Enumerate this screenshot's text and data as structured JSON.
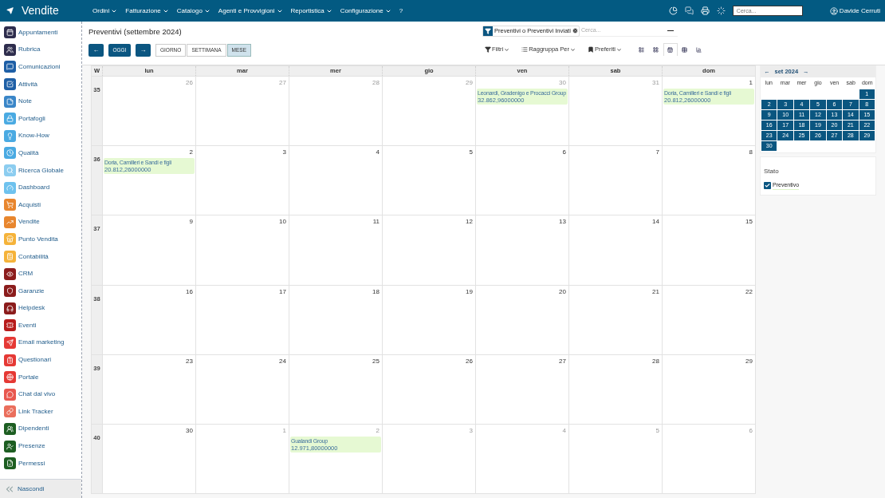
{
  "app": {
    "title": "Vendite"
  },
  "menus": [
    {
      "label": "Ordini",
      "dropdown": true
    },
    {
      "label": "Fatturazione",
      "dropdown": true
    },
    {
      "label": "Catalogo",
      "dropdown": true
    },
    {
      "label": "Agenti e Provvigioni",
      "dropdown": true
    },
    {
      "label": "Reportistica",
      "dropdown": true
    },
    {
      "label": "Configurazione",
      "dropdown": true
    },
    {
      "label": "?",
      "dropdown": false
    }
  ],
  "top_search": {
    "placeholder": "Cerca..."
  },
  "user": {
    "name": "Davide Cerruti"
  },
  "sidebar": {
    "items": [
      {
        "label": "Appuntamenti",
        "color": "#2e2d4d"
      },
      {
        "label": "Rubrica",
        "color": "#2e2d4d"
      },
      {
        "label": "Comunicazioni",
        "color": "#1e5fa6"
      },
      {
        "label": "Attività",
        "color": "#1e5fa6"
      },
      {
        "label": "Note",
        "color": "#3a86c8"
      },
      {
        "label": "Portafogli",
        "color": "#4aaae2"
      },
      {
        "label": "Know-How",
        "color": "#4aaae2"
      },
      {
        "label": "Qualità",
        "color": "#4aaae2"
      },
      {
        "label": "Ricerca Globale",
        "color": "#8ccdf0"
      },
      {
        "label": "Dashboard",
        "color": "#6ec2ee"
      },
      {
        "label": "Acquisti",
        "color": "#e8862e"
      },
      {
        "label": "Vendite",
        "color": "#e8862e"
      },
      {
        "label": "Punto Vendita",
        "color": "#f5b33a"
      },
      {
        "label": "Contabilità",
        "color": "#f5b33a"
      },
      {
        "label": "CRM",
        "color": "#8b1c1c"
      },
      {
        "label": "Garanzie",
        "color": "#8b1c1c"
      },
      {
        "label": "Helpdesk",
        "color": "#8b1c1c"
      },
      {
        "label": "Eventi",
        "color": "#b71c1c"
      },
      {
        "label": "Email marketing",
        "color": "#e53935"
      },
      {
        "label": "Questionari",
        "color": "#e53935"
      },
      {
        "label": "Portale",
        "color": "#e53935"
      },
      {
        "label": "Chat dal vivo",
        "color": "#e8574f"
      },
      {
        "label": "Link Tracker",
        "color": "#ea6e5c"
      },
      {
        "label": "Dipendenti",
        "color": "#1d5e22"
      },
      {
        "label": "Presenze",
        "color": "#1d5e22"
      },
      {
        "label": "Permessi",
        "color": "#1d5e22"
      }
    ],
    "hide_label": "Nascondi"
  },
  "page": {
    "title": "Preventivi (settembre 2024)"
  },
  "nav_buttons": {
    "prev": "←",
    "today": "OGGI",
    "next": "→"
  },
  "scales": [
    {
      "label": "GIORNO",
      "selected": false
    },
    {
      "label": "SETTIMANA",
      "selected": false
    },
    {
      "label": "MESE",
      "selected": true
    }
  ],
  "search": {
    "facet": "Preventivi o Preventivi Inviati",
    "placeholder": "Cerca..."
  },
  "search_options": [
    {
      "label": "Filtri",
      "kind": "filter"
    },
    {
      "label": "Raggruppa Per",
      "kind": "group"
    },
    {
      "label": "Preferiti",
      "kind": "favorite"
    }
  ],
  "views": [
    {
      "kind": "list",
      "selected": false
    },
    {
      "kind": "kanban",
      "selected": false
    },
    {
      "kind": "calendar",
      "selected": true
    },
    {
      "kind": "pivot",
      "selected": false
    },
    {
      "kind": "graph",
      "selected": false
    }
  ],
  "calendar": {
    "week_label": "W",
    "weekdays": [
      "lun",
      "mar",
      "mer",
      "gio",
      "ven",
      "sab",
      "dom"
    ],
    "weeks": [
      {
        "week": "35",
        "days": [
          {
            "day": "26",
            "other_month": true
          },
          {
            "day": "27",
            "other_month": true
          },
          {
            "day": "28",
            "other_month": true
          },
          {
            "day": "29",
            "other_month": true
          },
          {
            "day": "30",
            "other_month": true,
            "events": [
              {
                "title": "Leonardi, Gradenigo e Procacci Group",
                "amount": "32.862,96000000"
              }
            ]
          },
          {
            "day": "31",
            "other_month": true
          },
          {
            "day": "1",
            "other_month": false,
            "events": [
              {
                "title": "Doria, Camilleri e Sandi e figli",
                "amount": "20.812,26000000"
              }
            ]
          }
        ]
      },
      {
        "week": "36",
        "days": [
          {
            "day": "2",
            "other_month": false,
            "events": [
              {
                "title": "Doria, Camilleri e Sandi e figli",
                "amount": "20.812,26000000"
              }
            ]
          },
          {
            "day": "3",
            "other_month": false
          },
          {
            "day": "4",
            "other_month": false
          },
          {
            "day": "5",
            "other_month": false
          },
          {
            "day": "6",
            "other_month": false
          },
          {
            "day": "7",
            "other_month": false
          },
          {
            "day": "8",
            "other_month": false
          }
        ]
      },
      {
        "week": "37",
        "days": [
          {
            "day": "9",
            "other_month": false
          },
          {
            "day": "10",
            "other_month": false
          },
          {
            "day": "11",
            "other_month": false
          },
          {
            "day": "12",
            "other_month": false
          },
          {
            "day": "13",
            "other_month": false
          },
          {
            "day": "14",
            "other_month": false
          },
          {
            "day": "15",
            "other_month": false
          }
        ]
      },
      {
        "week": "38",
        "days": [
          {
            "day": "16",
            "other_month": false
          },
          {
            "day": "17",
            "other_month": false
          },
          {
            "day": "18",
            "other_month": false
          },
          {
            "day": "19",
            "other_month": false
          },
          {
            "day": "20",
            "other_month": false
          },
          {
            "day": "21",
            "other_month": false
          },
          {
            "day": "22",
            "other_month": false
          }
        ]
      },
      {
        "week": "39",
        "days": [
          {
            "day": "23",
            "other_month": false
          },
          {
            "day": "24",
            "other_month": false
          },
          {
            "day": "25",
            "other_month": false
          },
          {
            "day": "26",
            "other_month": false
          },
          {
            "day": "27",
            "other_month": false
          },
          {
            "day": "28",
            "other_month": false
          },
          {
            "day": "29",
            "other_month": false
          }
        ]
      },
      {
        "week": "40",
        "days": [
          {
            "day": "30",
            "other_month": false
          },
          {
            "day": "1",
            "other_month": true
          },
          {
            "day": "2",
            "other_month": true,
            "events": [
              {
                "title": "Gualandi Group",
                "amount": "12.971,80000000"
              }
            ]
          },
          {
            "day": "3",
            "other_month": true
          },
          {
            "day": "4",
            "other_month": true
          },
          {
            "day": "5",
            "other_month": true
          },
          {
            "day": "6",
            "other_month": true
          }
        ]
      }
    ]
  },
  "mini_calendar": {
    "prev": "←",
    "title": "set 2024",
    "next": "→",
    "weekdays": [
      "lun",
      "mar",
      "mer",
      "gio",
      "ven",
      "sab",
      "dom"
    ],
    "weeks": [
      [
        "1"
      ],
      [
        "2",
        "3",
        "4",
        "5",
        "6",
        "7",
        "8"
      ],
      [
        "9",
        "10",
        "11",
        "12",
        "13",
        "14",
        "15"
      ],
      [
        "16",
        "17",
        "18",
        "19",
        "20",
        "21",
        "22"
      ],
      [
        "23",
        "24",
        "25",
        "26",
        "27",
        "28",
        "29"
      ],
      [
        "30"
      ]
    ]
  },
  "filter_panel": {
    "title": "Stato",
    "options": [
      {
        "label": "Preventivo",
        "checked": true
      }
    ]
  }
}
